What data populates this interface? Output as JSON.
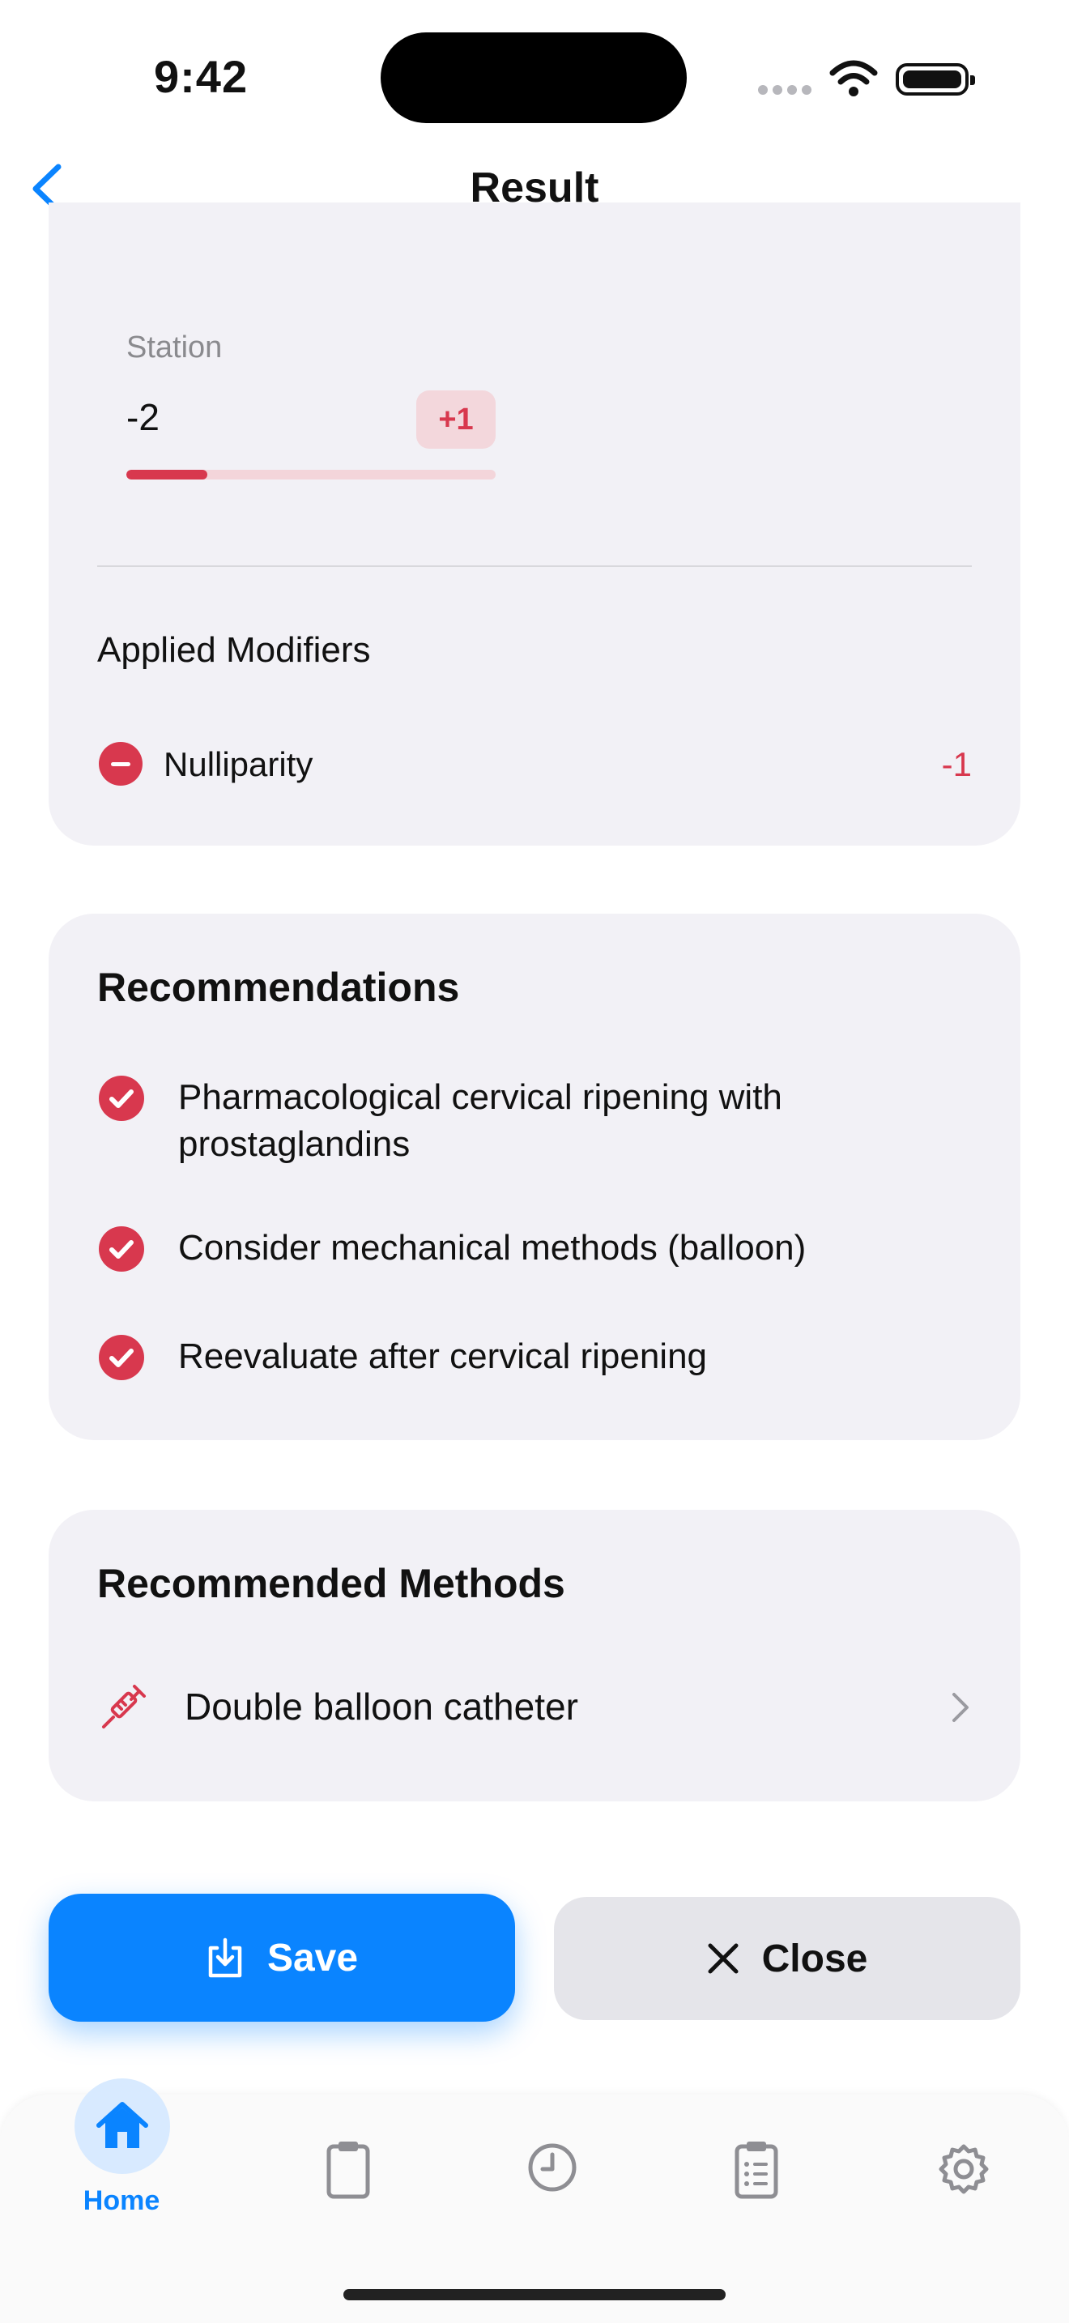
{
  "status_bar": {
    "time": "9:42"
  },
  "nav": {
    "title": "Result"
  },
  "station": {
    "label": "Station",
    "value": "-2",
    "badge": "+1",
    "progress": 0.22
  },
  "modifiers": {
    "title": "Applied Modifiers",
    "items": [
      {
        "label": "Nulliparity",
        "value": "-1"
      }
    ]
  },
  "recommendations": {
    "title": "Recommendations",
    "items": [
      "Pharmacological cervical ripening with prostaglandins",
      "Consider mechanical methods (balloon)",
      "Reevaluate after cervical ripening"
    ]
  },
  "methods": {
    "title": "Recommended Methods",
    "items": [
      {
        "label": "Double balloon catheter",
        "icon": "syringe-icon"
      }
    ]
  },
  "actions": {
    "save_label": "Save",
    "close_label": "Close"
  },
  "tabbar": {
    "active": "Home",
    "tabs": [
      {
        "name": "Home",
        "icon": "house-icon"
      },
      {
        "name": "",
        "icon": "clipboard-icon"
      },
      {
        "name": "",
        "icon": "clock-icon"
      },
      {
        "name": "",
        "icon": "checklist-icon"
      },
      {
        "name": "",
        "icon": "gear-icon"
      }
    ]
  },
  "colors": {
    "accent": "#0a84ff",
    "danger": "#d8384e",
    "card": "#f2f1f6"
  }
}
